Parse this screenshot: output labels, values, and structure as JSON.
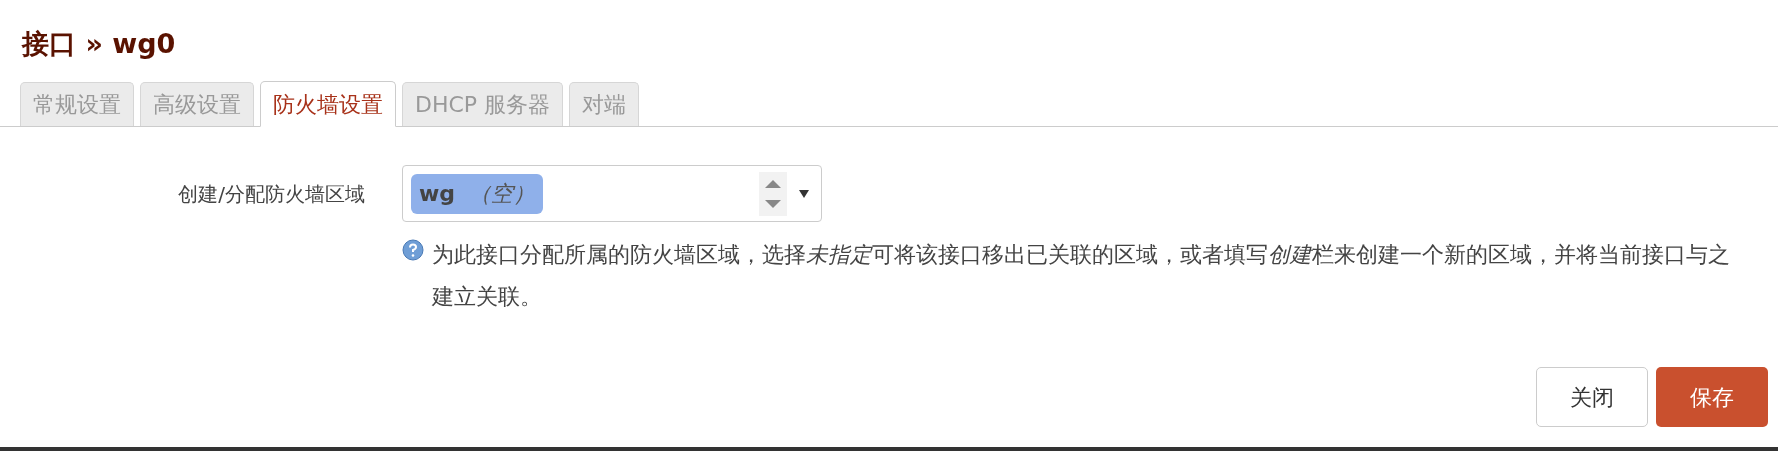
{
  "title": "接口 » wg0",
  "tabs": [
    {
      "label": "常规设置",
      "selected": false
    },
    {
      "label": "高级设置",
      "selected": false
    },
    {
      "label": "防火墙设置",
      "selected": true
    },
    {
      "label": "DHCP 服务器",
      "selected": false
    },
    {
      "label": "对端",
      "selected": false
    }
  ],
  "field": {
    "label": "创建/分配防火墙区域",
    "chip_name": "wg",
    "chip_note": "（空）",
    "help": [
      {
        "text": "为此接口分配所属的防火墙区域，选择",
        "italic": false
      },
      {
        "text": "未指定",
        "italic": true
      },
      {
        "text": "可将该接口移出已关联的区域，或者填写",
        "italic": false
      },
      {
        "text": "创建",
        "italic": true
      },
      {
        "text": "栏来创建一个新的区域，并将当前接口与之建立关联。",
        "italic": false
      }
    ]
  },
  "buttons": [
    {
      "label": "关闭",
      "kind": "neutral"
    },
    {
      "label": "保存",
      "kind": "primary"
    }
  ]
}
